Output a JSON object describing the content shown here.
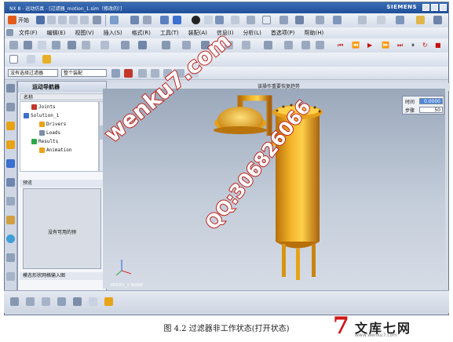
{
  "window": {
    "title": "NX 8 - 运动仿真 - [过滤器_motion_1.sim（修改的）]",
    "brand": "SIEMENS"
  },
  "toolbar": {
    "start_label": "开始",
    "menu_items": [
      "文件(F)",
      "编辑(E)",
      "视图(V)",
      "插入(S)",
      "格式(R)",
      "工具(T)",
      "装配(A)",
      "信息(I)",
      "分析(L)",
      "首选项(P)",
      "帮助(H)"
    ]
  },
  "filter_bar": {
    "selection_filter": "没有选择过滤器",
    "assembly_scope": "整个装配"
  },
  "graphics": {
    "title": "该操作重要恢复趋势",
    "model_label": "MODEL_1 WORK"
  },
  "navigator": {
    "title": "运动导航器",
    "column_name": "名称",
    "tree": [
      {
        "label": "Joints",
        "level": 1
      },
      {
        "label": "Solution_1",
        "level": 0
      },
      {
        "label": "Drivers",
        "level": 2
      },
      {
        "label": "Loads",
        "level": 2
      },
      {
        "label": "Results",
        "level": 1
      },
      {
        "label": "Animation",
        "level": 2
      }
    ],
    "preview_label": "预览",
    "preview_message": "没有可用的预",
    "dependency_label": "模态形状网格输入图"
  },
  "animation_panel": {
    "time_label": "时间",
    "time_value": "0.0000",
    "step_label": "步骤",
    "step_value": "50"
  },
  "caption": "图 4.2  过滤器非工作状态(打开状态)",
  "watermarks": [
    "wenku7.com",
    "QQ:306826066"
  ],
  "logo": {
    "seven": "7",
    "text": "文库七网",
    "url": "www.wenku7.com"
  },
  "colors": {
    "accent_title": "#1f4f99",
    "vessel_orange": "#e8a316",
    "watermark_stroke": "#c0211b",
    "logo_red": "#d01818"
  }
}
